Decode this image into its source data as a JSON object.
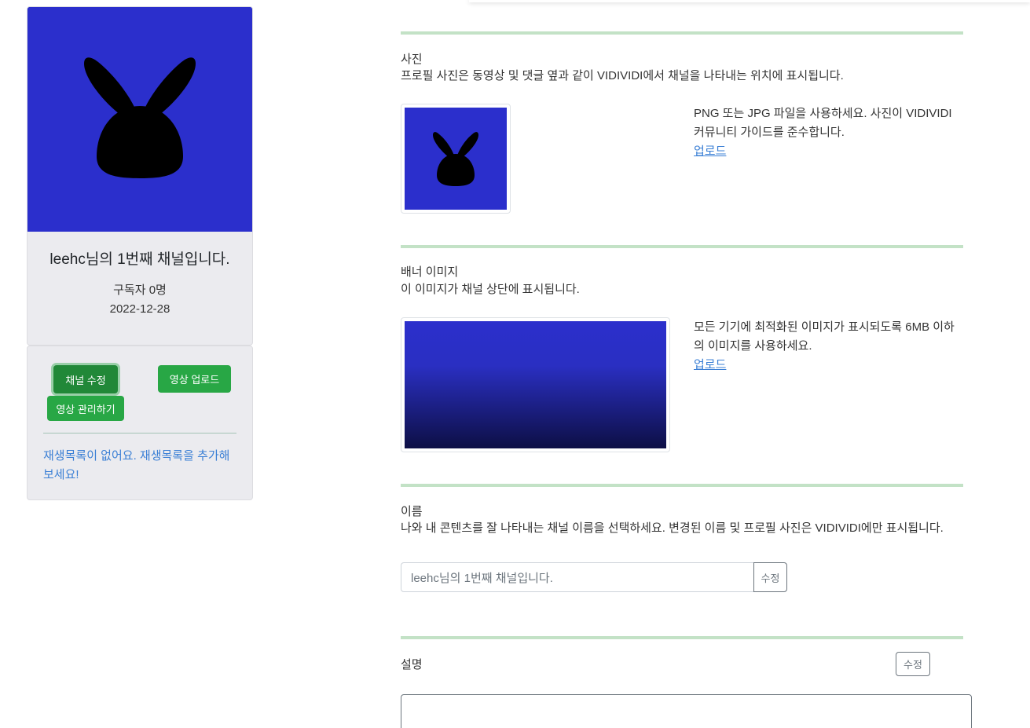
{
  "channel_card": {
    "title": "leehc님의 1번째 채널입니다.",
    "subscribers": "구독자 0명",
    "date": "2022-12-28",
    "avatar_color": "#2b2fcc"
  },
  "actions": {
    "edit_channel": "채널 수정",
    "upload_video": "영상 업로드",
    "manage_videos": "영상 관리하기",
    "playlist_empty": "재생목록이 없어요. 재생목록을 추가해보세요!"
  },
  "photo_section": {
    "label": "사진",
    "description": "프로필 사진은 동영상 및 댓글 옆과 같이 VIDIVIDI에서 채널을 나타내는 위치에 표시됩니다.",
    "hint": "PNG 또는 JPG 파일을 사용하세요. 사진이 VIDIVIDI 커뮤니티 가이드를 준수합니다.",
    "upload_link": "업로드"
  },
  "banner_section": {
    "label": "배너 이미지",
    "description": "이 이미지가 채널 상단에 표시됩니다.",
    "hint": "모든 기기에 최적화된 이미지가 표시되도록 6MB 이하의 이미지를 사용하세요.",
    "upload_link": "업로드"
  },
  "name_section": {
    "label": "이름",
    "description": "나와 내 콘텐츠를 잘 나타내는 채널 이름을 선택하세요. 변경된 이름 및 프로필 사진은 VIDIVIDI에만 표시됩니다.",
    "input_placeholder": "leehc님의 1번째 채널입니다.",
    "edit_button": "수정"
  },
  "description_section": {
    "label": "설명",
    "edit_button": "수정"
  },
  "colors": {
    "accent_green": "#28a745",
    "divider_green": "#c3e2c6",
    "link_blue": "#3a7fd5"
  }
}
